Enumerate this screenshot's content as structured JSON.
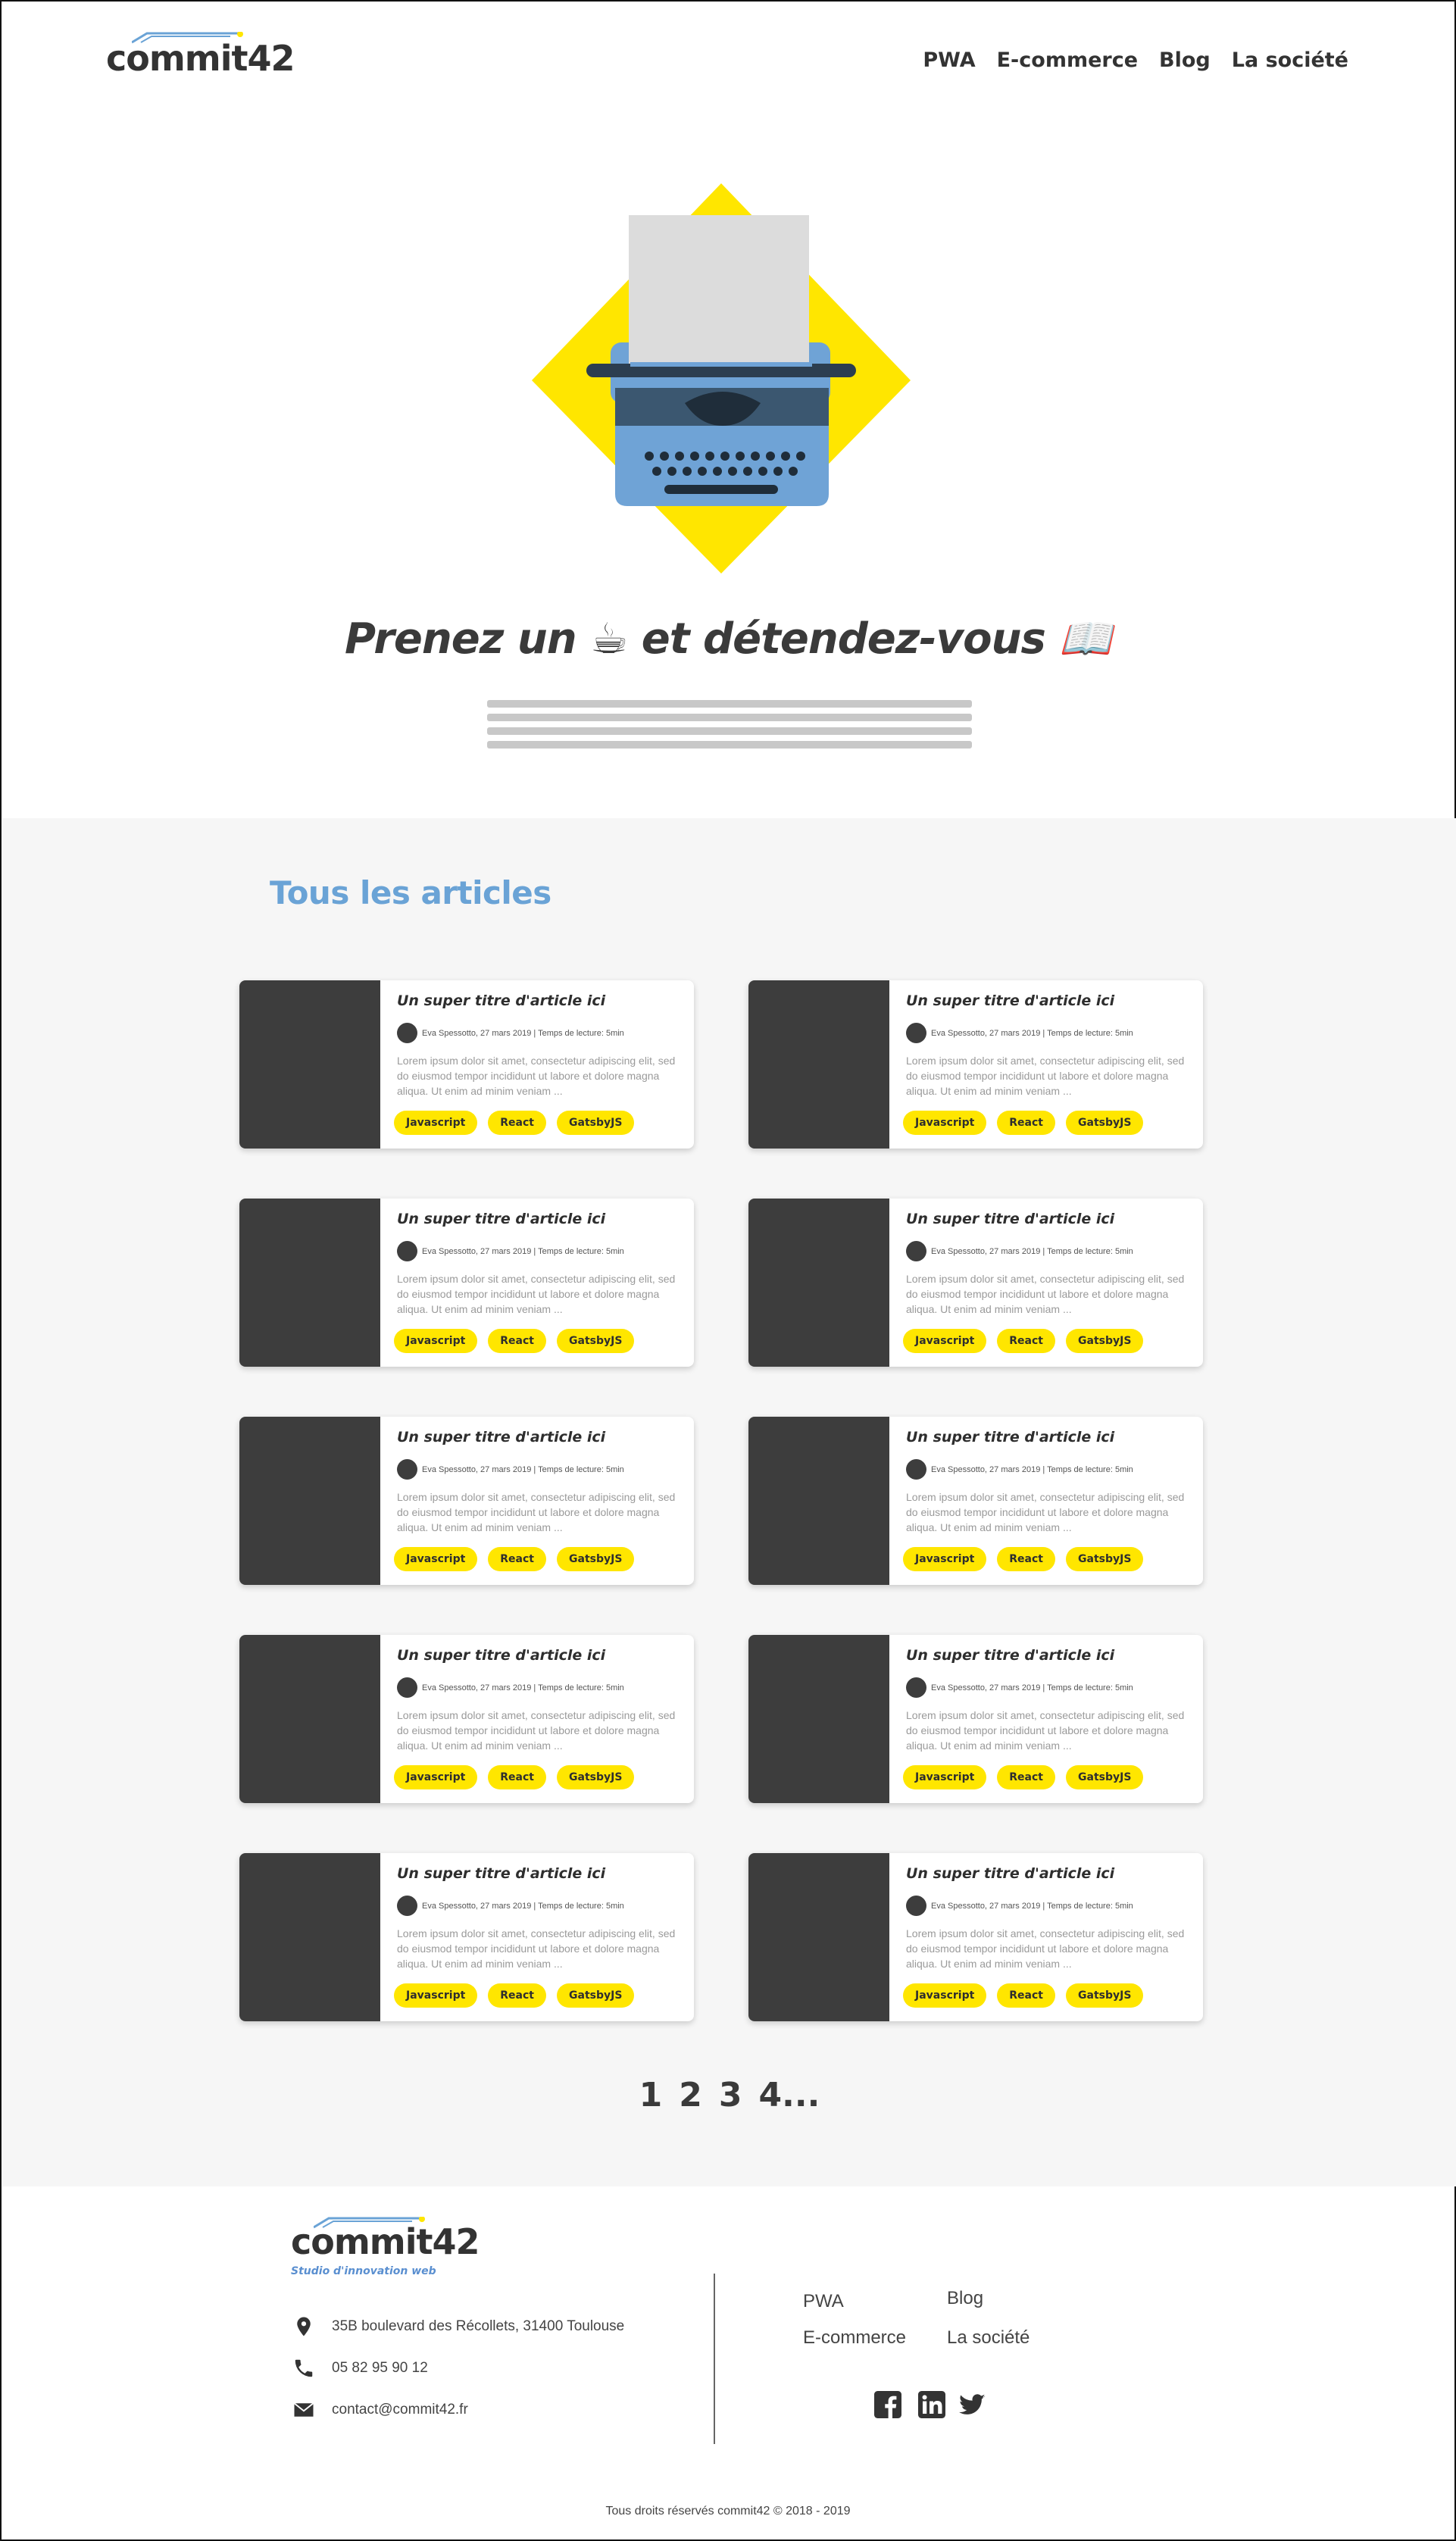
{
  "header": {
    "logo_text": "commit42",
    "nav": [
      "PWA",
      "E-commerce",
      "Blog",
      "La société"
    ]
  },
  "hero": {
    "title": "Prenez un ☕ et détendez-vous 📖"
  },
  "articles_section": {
    "title": "Tous les articles",
    "cards": [
      {
        "title": "Un super titre d'article ici",
        "meta": "Eva Spessotto, 27 mars 2019 | Temps de lecture: 5min",
        "excerpt": "Lorem ipsum dolor sit amet, consectetur adipiscing elit, sed do eiusmod tempor incididunt ut labore et dolore magna aliqua. Ut enim ad minim veniam ...",
        "tags": [
          "Javascript",
          "React",
          "GatsbyJS"
        ]
      },
      {
        "title": "Un super titre d'article ici",
        "meta": "Eva Spessotto, 27 mars 2019 | Temps de lecture: 5min",
        "excerpt": "Lorem ipsum dolor sit amet, consectetur adipiscing elit, sed do eiusmod tempor incididunt ut labore et dolore magna aliqua. Ut enim ad minim veniam ...",
        "tags": [
          "Javascript",
          "React",
          "GatsbyJS"
        ]
      },
      {
        "title": "Un super titre d'article ici",
        "meta": "Eva Spessotto, 27 mars 2019 | Temps de lecture: 5min",
        "excerpt": "Lorem ipsum dolor sit amet, consectetur adipiscing elit, sed do eiusmod tempor incididunt ut labore et dolore magna aliqua. Ut enim ad minim veniam ...",
        "tags": [
          "Javascript",
          "React",
          "GatsbyJS"
        ]
      },
      {
        "title": "Un super titre d'article ici",
        "meta": "Eva Spessotto, 27 mars 2019 | Temps de lecture: 5min",
        "excerpt": "Lorem ipsum dolor sit amet, consectetur adipiscing elit, sed do eiusmod tempor incididunt ut labore et dolore magna aliqua. Ut enim ad minim veniam ...",
        "tags": [
          "Javascript",
          "React",
          "GatsbyJS"
        ]
      },
      {
        "title": "Un super titre d'article ici",
        "meta": "Eva Spessotto, 27 mars 2019 | Temps de lecture: 5min",
        "excerpt": "Lorem ipsum dolor sit amet, consectetur adipiscing elit, sed do eiusmod tempor incididunt ut labore et dolore magna aliqua. Ut enim ad minim veniam ...",
        "tags": [
          "Javascript",
          "React",
          "GatsbyJS"
        ]
      },
      {
        "title": "Un super titre d'article ici",
        "meta": "Eva Spessotto, 27 mars 2019 | Temps de lecture: 5min",
        "excerpt": "Lorem ipsum dolor sit amet, consectetur adipiscing elit, sed do eiusmod tempor incididunt ut labore et dolore magna aliqua. Ut enim ad minim veniam ...",
        "tags": [
          "Javascript",
          "React",
          "GatsbyJS"
        ]
      },
      {
        "title": "Un super titre d'article ici",
        "meta": "Eva Spessotto, 27 mars 2019 | Temps de lecture: 5min",
        "excerpt": "Lorem ipsum dolor sit amet, consectetur adipiscing elit, sed do eiusmod tempor incididunt ut labore et dolore magna aliqua. Ut enim ad minim veniam ...",
        "tags": [
          "Javascript",
          "React",
          "GatsbyJS"
        ]
      },
      {
        "title": "Un super titre d'article ici",
        "meta": "Eva Spessotto, 27 mars 2019 | Temps de lecture: 5min",
        "excerpt": "Lorem ipsum dolor sit amet, consectetur adipiscing elit, sed do eiusmod tempor incididunt ut labore et dolore magna aliqua. Ut enim ad minim veniam ...",
        "tags": [
          "Javascript",
          "React",
          "GatsbyJS"
        ]
      },
      {
        "title": "Un super titre d'article ici",
        "meta": "Eva Spessotto, 27 mars 2019 | Temps de lecture: 5min",
        "excerpt": "Lorem ipsum dolor sit amet, consectetur adipiscing elit, sed do eiusmod tempor incididunt ut labore et dolore magna aliqua. Ut enim ad minim veniam ...",
        "tags": [
          "Javascript",
          "React",
          "GatsbyJS"
        ]
      },
      {
        "title": "Un super titre d'article ici",
        "meta": "Eva Spessotto, 27 mars 2019 | Temps de lecture: 5min",
        "excerpt": "Lorem ipsum dolor sit amet, consectetur adipiscing elit, sed do eiusmod tempor incididunt ut labore et dolore magna aliqua. Ut enim ad minim veniam ...",
        "tags": [
          "Javascript",
          "React",
          "GatsbyJS"
        ]
      }
    ],
    "pagination": [
      "1",
      "2",
      "3",
      "4..."
    ]
  },
  "footer": {
    "logo_text": "commit42",
    "tagline": "Studio d'innovation web",
    "address": "35B boulevard des Récollets, 31400 Toulouse",
    "phone": "05 82 95 90 12",
    "email": "contact@commit42.fr",
    "links": [
      "PWA",
      "Blog",
      "E-commerce",
      "La société"
    ],
    "social": [
      "facebook-icon",
      "linkedin-icon",
      "twitter-icon"
    ],
    "copyright": "Tous droits réservés commit42 © 2018 - 2019"
  },
  "colors": {
    "accent_yellow": "#ffe600",
    "accent_blue": "#6aa3d6",
    "dark": "#3d3d3d",
    "section_bg": "#f6f6f6"
  }
}
